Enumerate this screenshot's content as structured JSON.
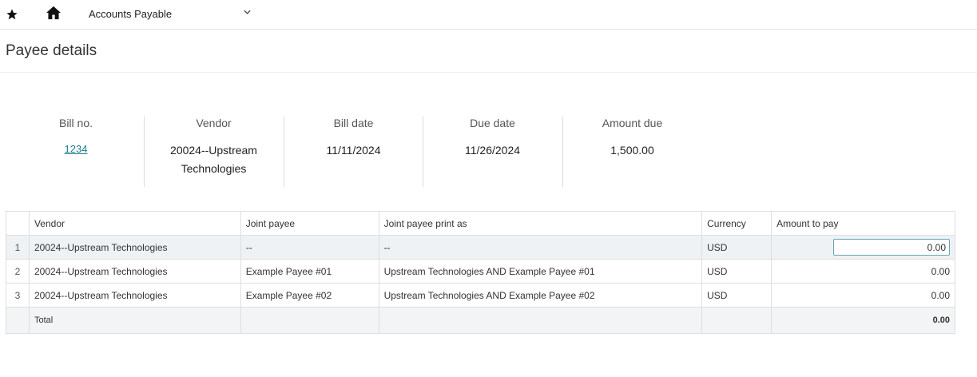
{
  "topbar": {
    "app_name": "Accounts Payable"
  },
  "page": {
    "title": "Payee details"
  },
  "summary": {
    "bill_no_label": "Bill no.",
    "bill_no": "1234",
    "vendor_label": "Vendor",
    "vendor_line1": "20024--Upstream",
    "vendor_line2": "Technologies",
    "bill_date_label": "Bill date",
    "bill_date": "11/11/2024",
    "due_date_label": "Due date",
    "due_date": "11/26/2024",
    "amount_due_label": "Amount due",
    "amount_due": "1,500.00"
  },
  "grid": {
    "headers": {
      "vendor": "Vendor",
      "joint_payee": "Joint payee",
      "print_as": "Joint payee print as",
      "currency": "Currency",
      "amount": "Amount to pay"
    },
    "rows": [
      {
        "num": "1",
        "vendor": "20024--Upstream Technologies",
        "joint_payee": "--",
        "print_as": "--",
        "currency": "USD",
        "amount": "0.00"
      },
      {
        "num": "2",
        "vendor": "20024--Upstream Technologies",
        "joint_payee": "Example Payee #01",
        "print_as": "Upstream Technologies AND Example Payee #01",
        "currency": "USD",
        "amount": "0.00"
      },
      {
        "num": "3",
        "vendor": "20024--Upstream Technologies",
        "joint_payee": "Example Payee #02",
        "print_as": "Upstream Technologies AND Example Payee #02",
        "currency": "USD",
        "amount": "0.00"
      }
    ],
    "total_label": "Total",
    "total_amount": "0.00"
  }
}
